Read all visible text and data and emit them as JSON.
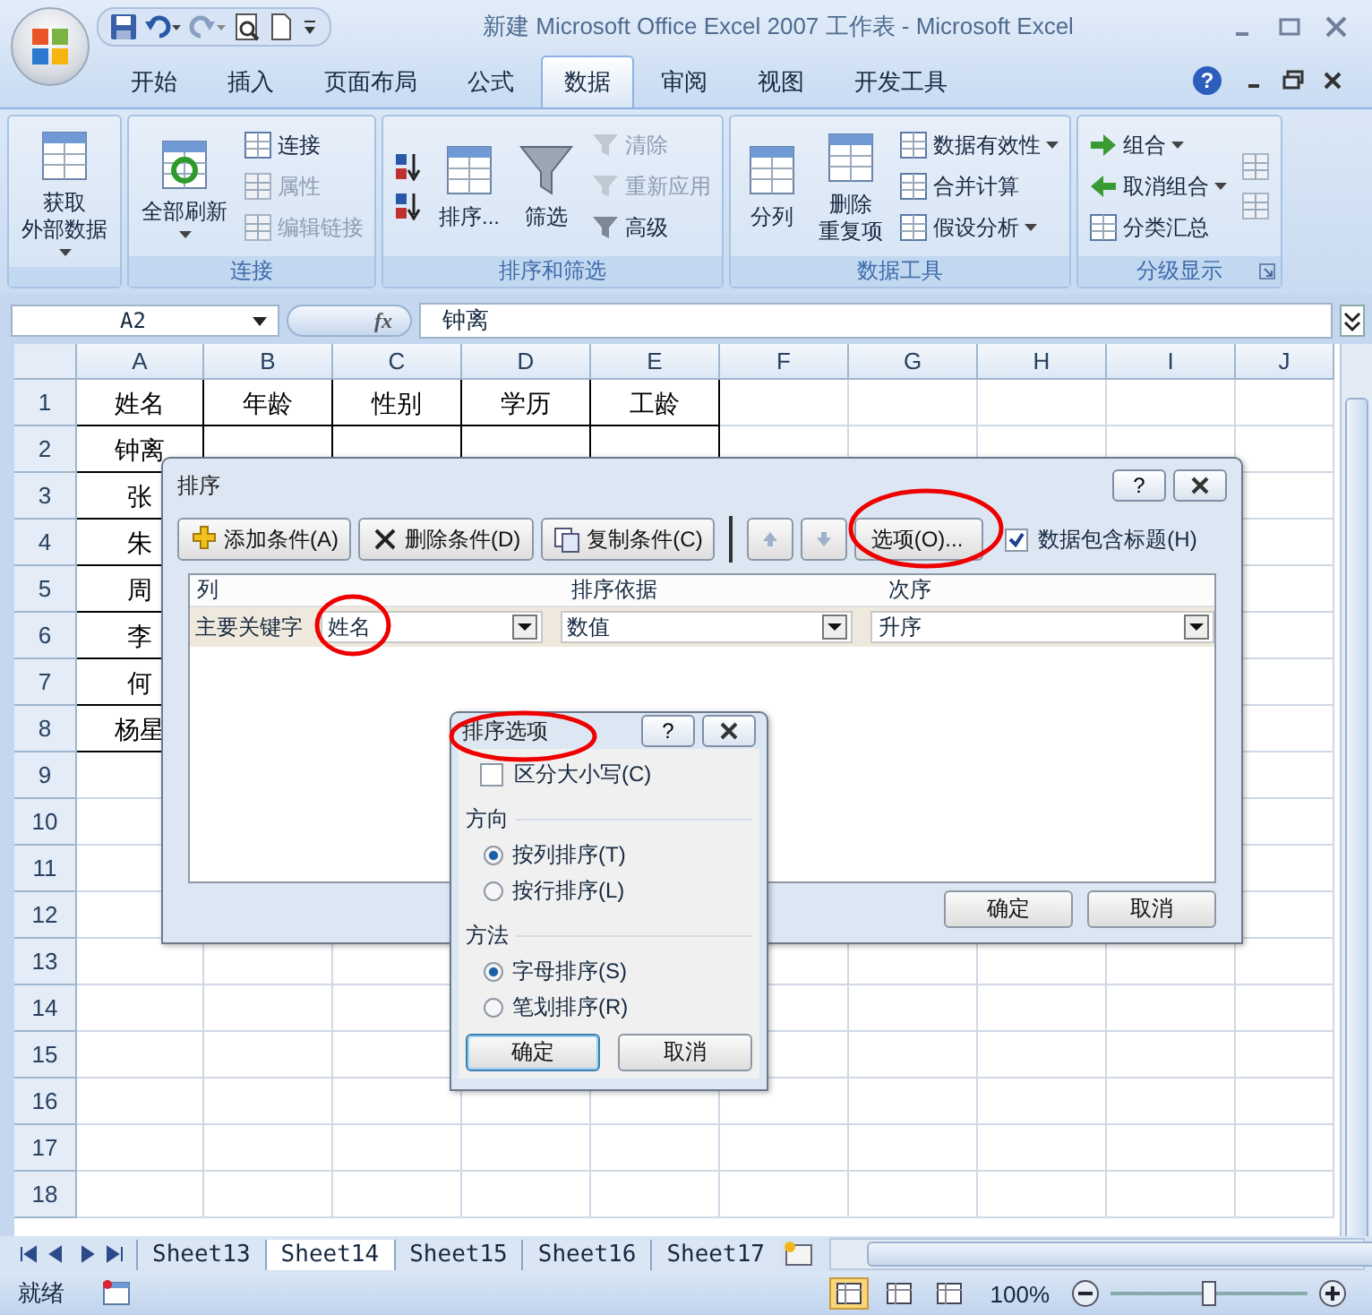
{
  "window": {
    "title": "新建 Microsoft Office Excel 2007 工作表 - Microsoft Excel"
  },
  "tabs": [
    {
      "label": "开始",
      "selected": false
    },
    {
      "label": "插入",
      "selected": false
    },
    {
      "label": "页面布局",
      "selected": false
    },
    {
      "label": "公式",
      "selected": false
    },
    {
      "label": "数据",
      "selected": true
    },
    {
      "label": "审阅",
      "selected": false
    },
    {
      "label": "视图",
      "selected": false
    },
    {
      "label": "开发工具",
      "selected": false
    }
  ],
  "ribbon_help": "?",
  "ribbon": [
    {
      "columns": [
        [
          {
            "kind": "large",
            "lines": [
              "获取",
              "外部数据"
            ],
            "dropdown": true,
            "disabled": false
          }
        ]
      ]
    },
    {
      "title": "连接",
      "columns": [
        [
          {
            "kind": "large",
            "lines": [
              "全部刷新"
            ],
            "dropdown": true,
            "disabled": false
          }
        ],
        [
          {
            "kind": "small",
            "label": "连接",
            "disabled": false
          },
          {
            "kind": "small",
            "label": "属性",
            "disabled": true
          },
          {
            "kind": "small",
            "label": "编辑链接",
            "disabled": true
          }
        ]
      ]
    },
    {
      "title": "排序和筛选",
      "columns": [
        [
          {
            "kind": "icon",
            "disabled": false
          },
          {
            "kind": "icon",
            "disabled": false
          }
        ],
        [
          {
            "kind": "large",
            "lines": [
              "排序..."
            ],
            "disabled": false
          }
        ],
        [
          {
            "kind": "large",
            "lines": [
              "筛选"
            ],
            "disabled": false
          }
        ],
        [
          {
            "kind": "small",
            "label": "清除",
            "disabled": true
          },
          {
            "kind": "small",
            "label": "重新应用",
            "disabled": true
          },
          {
            "kind": "small",
            "label": "高级",
            "disabled": false
          }
        ]
      ]
    },
    {
      "title": "数据工具",
      "columns": [
        [
          {
            "kind": "large",
            "lines": [
              "分列"
            ],
            "disabled": false
          }
        ],
        [
          {
            "kind": "large",
            "lines": [
              "删除",
              "重复项"
            ],
            "disabled": false
          }
        ],
        [
          {
            "kind": "small",
            "label": "数据有效性",
            "dropdown": true,
            "disabled": false
          },
          {
            "kind": "small",
            "label": "合并计算",
            "disabled": false
          },
          {
            "kind": "small",
            "label": "假设分析",
            "dropdown": true,
            "disabled": false
          }
        ]
      ]
    },
    {
      "title": "分级显示",
      "launcher": true,
      "columns": [
        [
          {
            "kind": "small",
            "label": "组合",
            "dropdown": true,
            "disabled": false
          },
          {
            "kind": "small",
            "label": "取消组合",
            "dropdown": true,
            "disabled": false
          },
          {
            "kind": "small",
            "label": "分类汇总",
            "disabled": false
          }
        ],
        [
          {
            "kind": "icon",
            "disabled": true
          },
          {
            "kind": "icon",
            "disabled": true
          }
        ]
      ]
    }
  ],
  "formula_bar": {
    "name_box": "A2",
    "function_label": "fx",
    "value": "钟离"
  },
  "columns": [
    "A",
    "B",
    "C",
    "D",
    "E",
    "F",
    "G",
    "H",
    "I",
    "J"
  ],
  "rows": [
    {
      "number": "1",
      "bordered": true,
      "cells": [
        "姓名",
        "年龄",
        "性别",
        "学历",
        "工龄"
      ]
    },
    {
      "number": "2",
      "bordered": true,
      "cells": [
        "钟离"
      ]
    },
    {
      "number": "3",
      "bordered": true,
      "cells": [
        "张"
      ]
    },
    {
      "number": "4",
      "bordered": true,
      "cells": [
        "朱"
      ]
    },
    {
      "number": "5",
      "bordered": true,
      "cells": [
        "周"
      ]
    },
    {
      "number": "6",
      "bordered": true,
      "cells": [
        "李"
      ]
    },
    {
      "number": "7",
      "bordered": true,
      "cells": [
        "何"
      ]
    },
    {
      "number": "8",
      "bordered": true,
      "cells": [
        "杨星"
      ]
    },
    {
      "number": "9"
    },
    {
      "number": "10"
    },
    {
      "number": "11"
    },
    {
      "number": "12"
    },
    {
      "number": "13"
    },
    {
      "number": "14"
    },
    {
      "number": "15"
    },
    {
      "number": "16"
    },
    {
      "number": "17"
    },
    {
      "number": "18"
    }
  ],
  "sort_dialog": {
    "title": "排序",
    "help": "?",
    "toolbar": [
      "添加条件(A)",
      "删除条件(D)",
      "复制条件(C)"
    ],
    "options_button": "选项(O)...",
    "header_checkbox": {
      "label": "数据包含标题(H)",
      "checked": true
    },
    "grid_headers": [
      "列",
      "排序依据",
      "次序"
    ],
    "levels": [
      {
        "label": "主要关键字",
        "column": "姓名",
        "sort_on": "数值",
        "order": "升序"
      }
    ],
    "buttons": [
      "确定",
      "取消"
    ]
  },
  "options_dialog": {
    "title": "排序选项",
    "help": "?",
    "case_sensitive": {
      "label": "区分大小写(C)",
      "checked": false
    },
    "sections": [
      {
        "title": "方向",
        "options": [
          {
            "label": "按列排序(T)",
            "selected": true
          },
          {
            "label": "按行排序(L)",
            "selected": false
          }
        ]
      },
      {
        "title": "方法",
        "options": [
          {
            "label": "字母排序(S)",
            "selected": true
          },
          {
            "label": "笔划排序(R)",
            "selected": false
          }
        ]
      }
    ],
    "buttons": [
      {
        "label": "确定",
        "default": true
      },
      {
        "label": "取消",
        "default": false
      }
    ]
  },
  "sheet_tabs": [
    {
      "label": "Sheet13",
      "selected": false
    },
    {
      "label": "Sheet14",
      "selected": true
    },
    {
      "label": "Sheet15",
      "selected": false
    },
    {
      "label": "Sheet16",
      "selected": false
    },
    {
      "label": "Sheet17",
      "selected": false
    }
  ],
  "status_bar": {
    "status": "就绪",
    "views": [
      {
        "selected": true
      },
      {
        "selected": false
      },
      {
        "selected": false
      }
    ],
    "zoom": "100%",
    "zoom_slider": {
      "level": 0.5
    }
  }
}
